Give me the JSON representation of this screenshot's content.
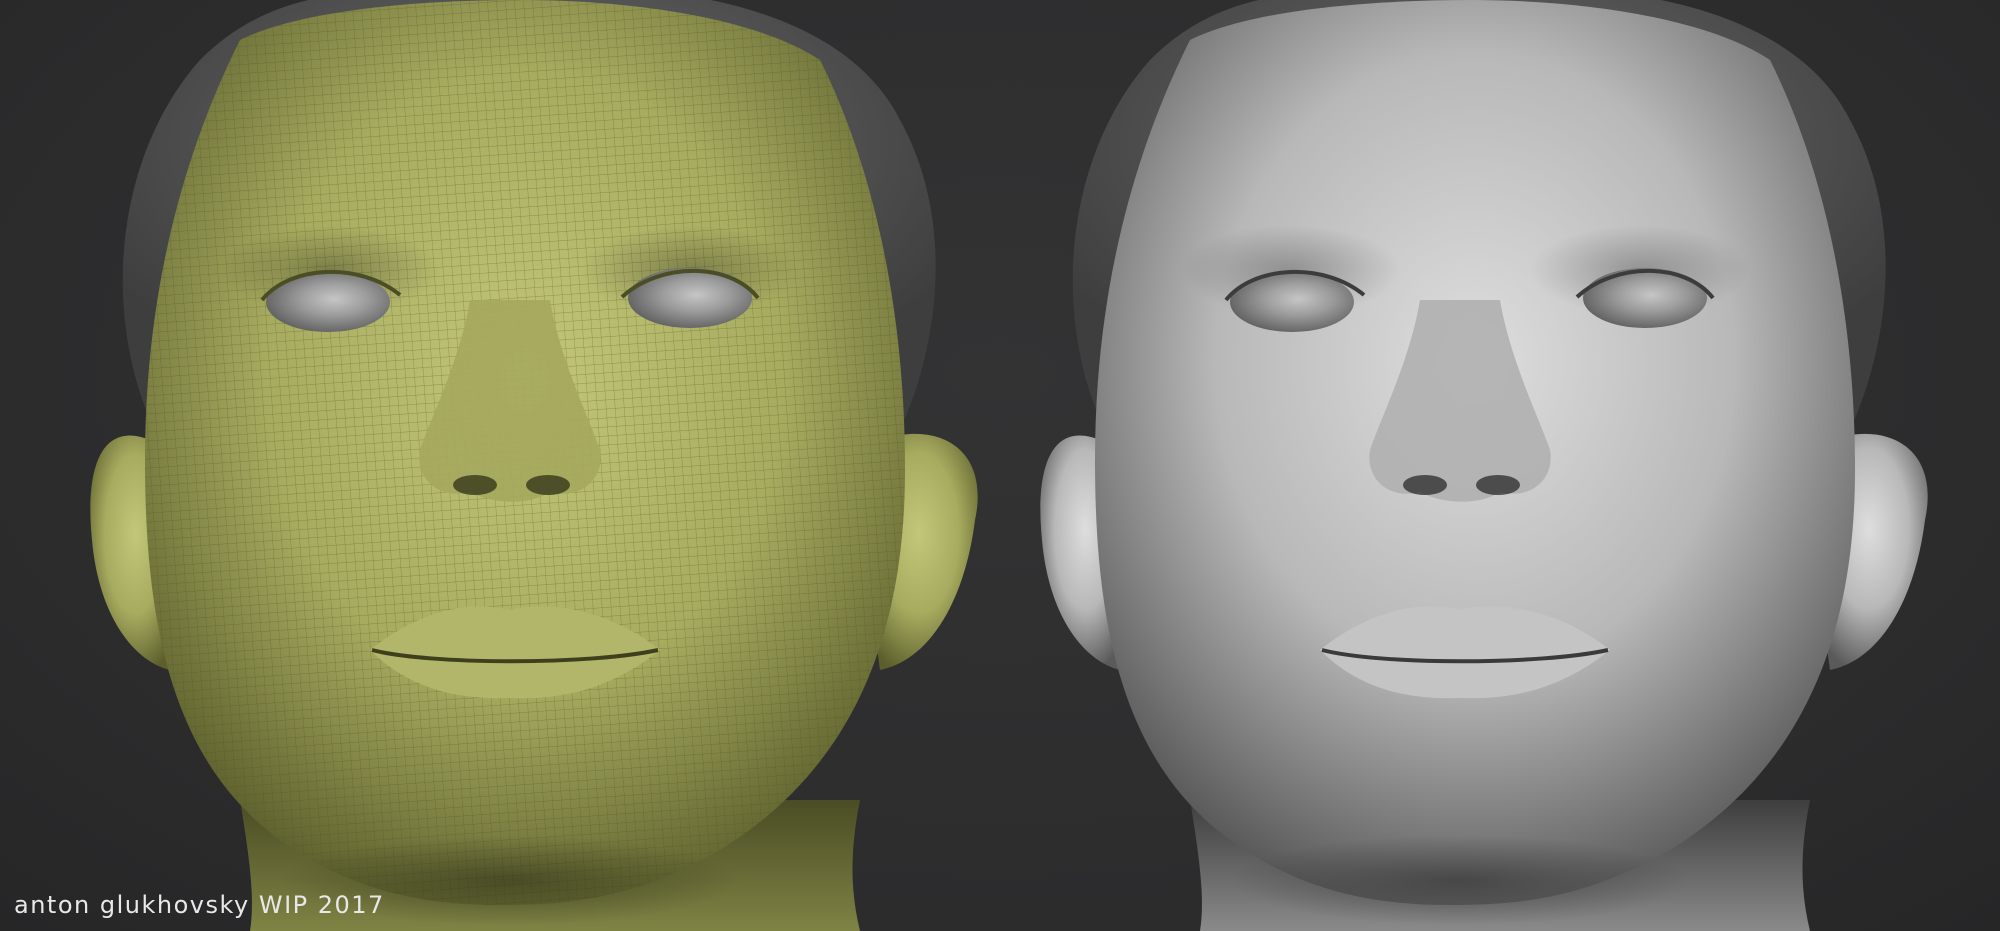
{
  "caption": "anton glukhovsky WIP 2017",
  "panels": [
    {
      "name": "wireframe-head-render",
      "shading": "polygroup wireframe",
      "color": "#a8ac62"
    },
    {
      "name": "clay-head-render",
      "shading": "clay",
      "color": "#b9b9b9"
    }
  ],
  "colors": {
    "background": "#2e2e2f",
    "hair": "#5f5f5f",
    "wire_skin": "#a8ac62",
    "clay_skin": "#b9b9b9",
    "eye": "#9a9a9a",
    "caption_text": "#e8e8e8"
  }
}
